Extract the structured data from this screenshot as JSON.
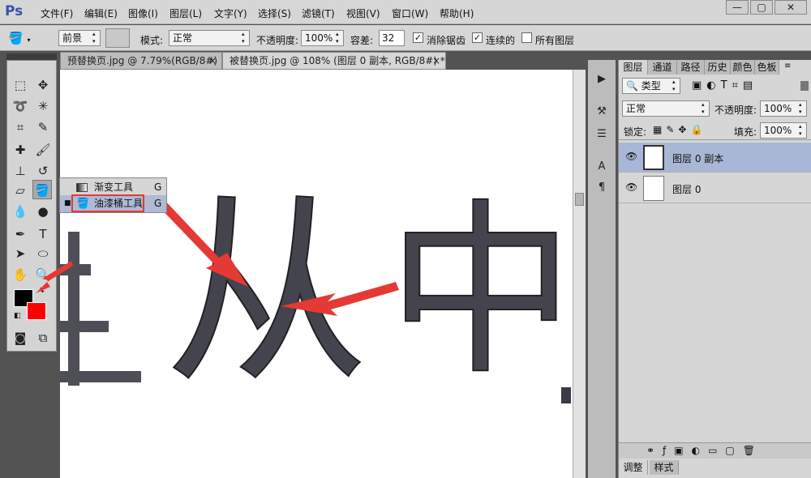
{
  "app": {
    "logo": "Ps"
  },
  "menu": [
    "文件(F)",
    "编辑(E)",
    "图像(I)",
    "图层(L)",
    "文字(Y)",
    "选择(S)",
    "滤镜(T)",
    "视图(V)",
    "窗口(W)",
    "帮助(H)"
  ],
  "options": {
    "fill_source": "前景",
    "mode_label": "模式:",
    "mode_value": "正常",
    "opacity_label": "不透明度:",
    "opacity_value": "100%",
    "tolerance_label": "容差:",
    "tolerance_value": "32",
    "antialias_label": "消除锯齿",
    "antialias_checked": true,
    "contiguous_label": "连续的",
    "contiguous_checked": true,
    "all_layers_label": "所有图层",
    "all_layers_checked": false
  },
  "tabs": [
    {
      "label": "预替换页.jpg @ 7.79%(RGB/8#)",
      "close": "×"
    },
    {
      "label": "被替换页.jpg @ 108% (图层 0 副本, RGB/8#) *",
      "close": "×"
    }
  ],
  "flyout": {
    "items": [
      {
        "label": "渐变工具",
        "shortcut": "G"
      },
      {
        "label": "油漆桶工具",
        "shortcut": "G"
      }
    ]
  },
  "canvas_text": {
    "char1": "从",
    "char2": "中"
  },
  "colors": {
    "foreground": "#000000",
    "background": "#ff0000",
    "accent": "#e53935"
  },
  "layers_panel": {
    "tabs": [
      "图层",
      "通道",
      "路径",
      "历史",
      "颜色",
      "色板"
    ],
    "filter_label": "类型",
    "blend_mode": "正常",
    "opacity_label": "不透明度:",
    "opacity_value": "100%",
    "lock_label": "锁定:",
    "fill_label": "填充:",
    "fill_value": "100%",
    "layers": [
      {
        "name": "图层 0 副本",
        "selected": true
      },
      {
        "name": "图层 0",
        "selected": false
      }
    ],
    "bottom_tabs": [
      "调整",
      "样式"
    ]
  }
}
